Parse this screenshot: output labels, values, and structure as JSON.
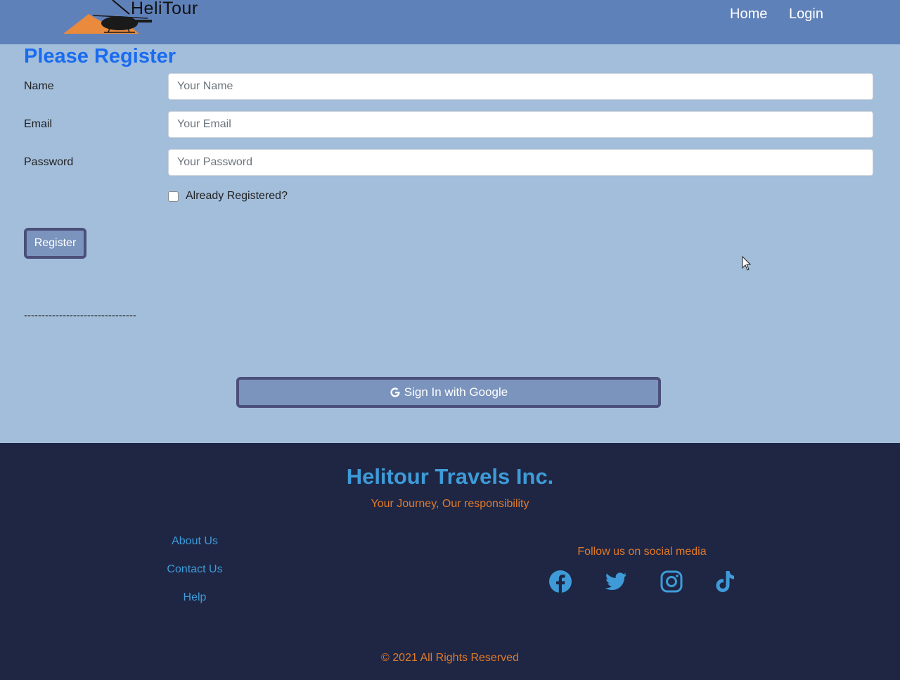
{
  "navbar": {
    "logo_text": "HeliTour",
    "links": [
      "Home",
      "Login"
    ]
  },
  "form": {
    "title": "Please Register",
    "fields": [
      {
        "label": "Name",
        "placeholder": "Your Name",
        "value": ""
      },
      {
        "label": "Email",
        "placeholder": "Your Email",
        "value": ""
      },
      {
        "label": "Password",
        "placeholder": "Your Password",
        "value": ""
      }
    ],
    "checkbox_label": "Already Registered?",
    "checkbox_checked": false,
    "register_label": "Register",
    "separator": "--------------------------------",
    "google_label": "Sign In with Google"
  },
  "footer": {
    "company": "Helitour Travels Inc.",
    "tagline": "Your Journey, Our responsibility",
    "links": [
      "About Us",
      "Contact Us",
      "Help"
    ],
    "social_heading": "Follow us on social media",
    "social_icons": [
      "facebook-icon",
      "twitter-icon",
      "instagram-icon",
      "tiktok-icon"
    ],
    "copyright": "© 2021 All Rights Reserved"
  },
  "colors": {
    "navbar": "#5f81b9",
    "page_background": "#a2bedb",
    "title": "#1a6bf0",
    "button": "#7b94bd",
    "button_border": "#4b4f7a",
    "footer_background": "#1e2644",
    "footer_accent_blue": "#3e9bd8",
    "footer_accent_orange": "#e07a2b"
  }
}
